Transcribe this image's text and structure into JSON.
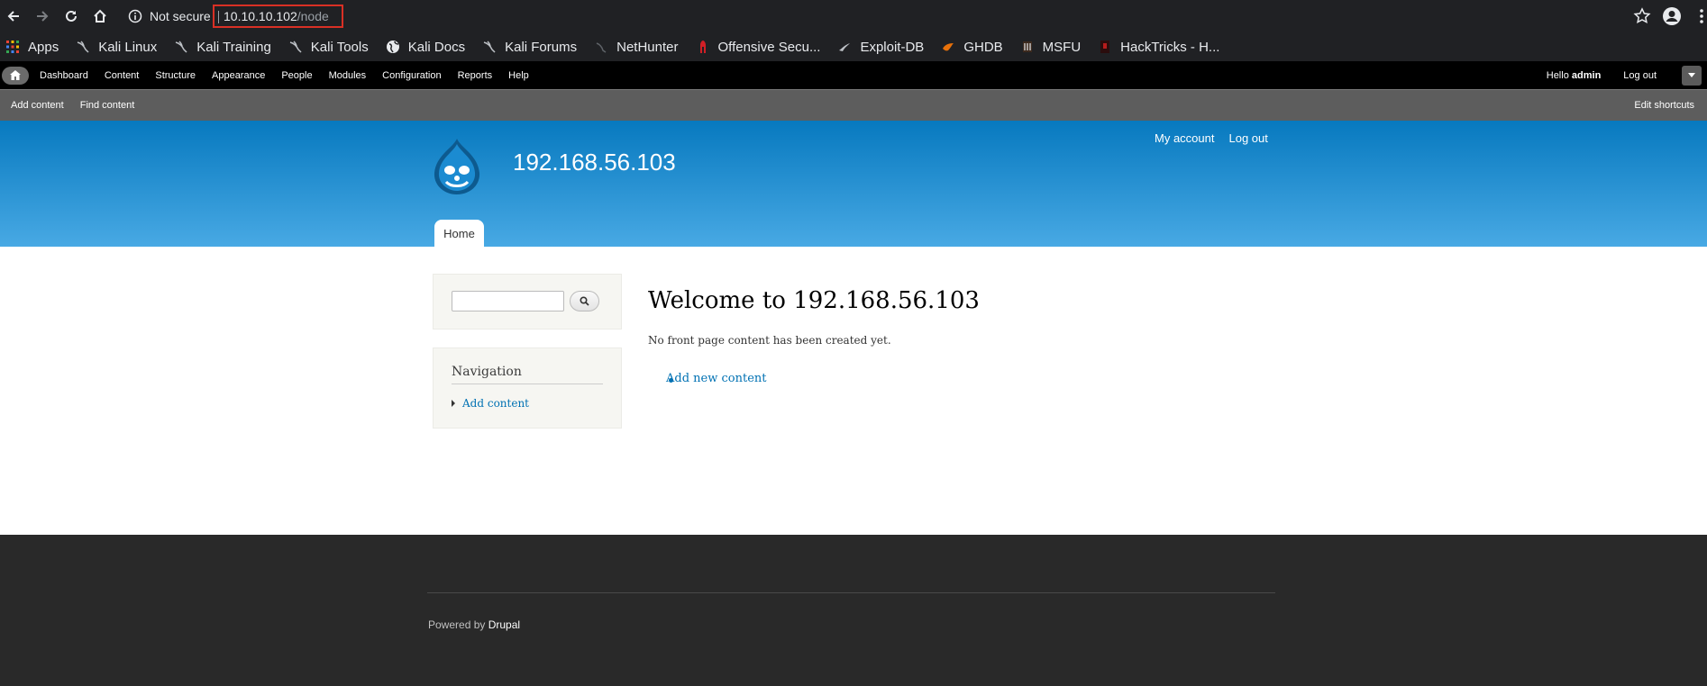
{
  "browser": {
    "not_secure": "Not secure",
    "url_host": "10.10.10.102",
    "url_path": "/node"
  },
  "bookmarks": [
    {
      "label": "Apps",
      "icon": "apps-grid-icon"
    },
    {
      "label": "Kali Linux",
      "icon": "kali-dragon-icon"
    },
    {
      "label": "Kali Training",
      "icon": "kali-dragon-icon"
    },
    {
      "label": "Kali Tools",
      "icon": "kali-dragon-icon"
    },
    {
      "label": "Kali Docs",
      "icon": "globe-icon"
    },
    {
      "label": "Kali Forums",
      "icon": "kali-dragon-icon"
    },
    {
      "label": "NetHunter",
      "icon": "nethunter-icon"
    },
    {
      "label": "Offensive Secu...",
      "icon": "offsec-icon"
    },
    {
      "label": "Exploit-DB",
      "icon": "exploitdb-icon"
    },
    {
      "label": "GHDB",
      "icon": "ghdb-icon"
    },
    {
      "label": "MSFU",
      "icon": "msfu-icon"
    },
    {
      "label": "HackTricks - H...",
      "icon": "hacktricks-icon"
    }
  ],
  "toolbar": {
    "items": [
      "Dashboard",
      "Content",
      "Structure",
      "Appearance",
      "People",
      "Modules",
      "Configuration",
      "Reports",
      "Help"
    ],
    "hello": "Hello",
    "username": "admin",
    "logout": "Log out"
  },
  "shortcuts": {
    "items": [
      "Add content",
      "Find content"
    ],
    "edit": "Edit shortcuts"
  },
  "header": {
    "site_name": "192.168.56.103",
    "my_account": "My account",
    "log_out": "Log out",
    "home_tab": "Home"
  },
  "sidebar": {
    "nav_title": "Navigation",
    "nav_item": "Add content"
  },
  "content": {
    "title": "Welcome to 192.168.56.103",
    "message": "No front page content has been created yet.",
    "add_link": "Add new content"
  },
  "footer": {
    "powered_by": "Powered by",
    "drupal": "Drupal"
  }
}
